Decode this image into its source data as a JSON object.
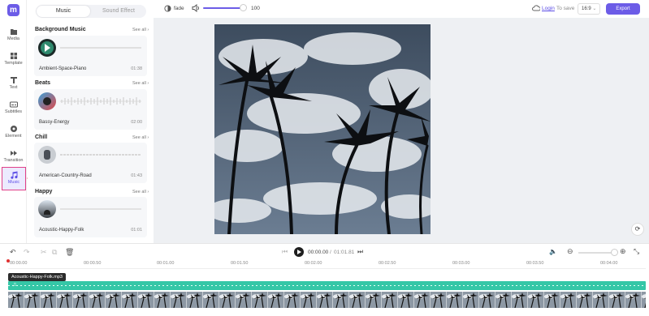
{
  "sidebar": {
    "items": [
      {
        "label": "Media",
        "icon": "folder-icon"
      },
      {
        "label": "Template",
        "icon": "grid-icon"
      },
      {
        "label": "Text",
        "icon": "text-icon"
      },
      {
        "label": "Subtitles",
        "icon": "subtitles-icon"
      },
      {
        "label": "Element",
        "icon": "element-icon"
      },
      {
        "label": "Transition",
        "icon": "transition-icon"
      },
      {
        "label": "Music",
        "icon": "music-note-icon"
      }
    ],
    "logo": "logo-icon"
  },
  "panel": {
    "tabs": [
      "Music",
      "Sound Effect"
    ],
    "see_all": "See all",
    "sections": [
      {
        "title": "Background Music",
        "track": "Ambient-Space-Piano",
        "duration": "01:38"
      },
      {
        "title": "Beats",
        "track": "Bassy-Energy",
        "duration": "02:00"
      },
      {
        "title": "Chill",
        "track": "American-Country-Road",
        "duration": "01:43"
      },
      {
        "title": "Happy",
        "track": "Acoustic-Happy-Folk",
        "duration": "01:01"
      }
    ]
  },
  "topbar": {
    "fade_label": "fade",
    "volume_value": "100",
    "volume_level": 1.0,
    "login_label": "Login",
    "to_save": "To save",
    "ratio": "16:9",
    "export_label": "Export"
  },
  "playback": {
    "current": "00:00.00",
    "separator": "/",
    "total": "01:01.81"
  },
  "timeline": {
    "ticks": [
      "00:00.00",
      "00:00.50",
      "00:01.00",
      "00:01.50",
      "00:02.00",
      "00:02.50",
      "00:03.00",
      "00:03.50",
      "00:04.00"
    ],
    "tooltip": "Acoustic-Happy-Folk.mp3",
    "zoom_level": 0.6
  },
  "colors": {
    "brand": "#6c5ce7",
    "audio_track": "#35c7a7",
    "highlight": "#e0408a"
  }
}
